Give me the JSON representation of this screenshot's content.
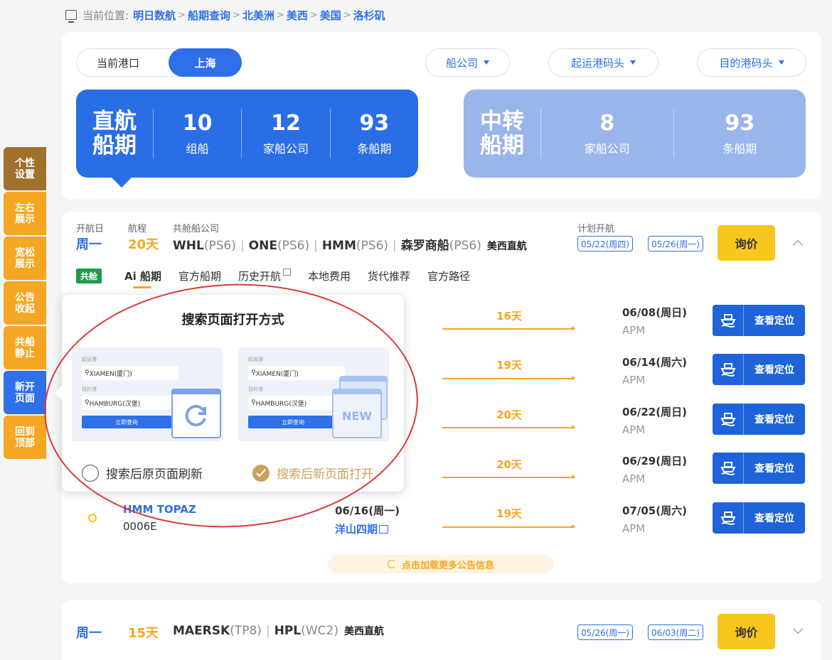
{
  "breadcrumb": {
    "prefix": "当前位置:",
    "items": [
      "明日数航",
      "船期查询",
      "北美洲",
      "美西",
      "美国",
      "洛杉矶"
    ],
    "sep": ">"
  },
  "port_bar": {
    "label": "当前港口",
    "selected": "上海",
    "dropdowns": [
      "船公司",
      "起运港码头",
      "目的港码头"
    ]
  },
  "stats": {
    "direct": {
      "title_line1": "直航",
      "title_line2": "船期",
      "cols": [
        {
          "num": "10",
          "label": "组船"
        },
        {
          "num": "12",
          "label": "家船公司"
        },
        {
          "num": "93",
          "label": "条船期"
        }
      ]
    },
    "transfer": {
      "title_line1": "中转",
      "title_line2": "船期",
      "cols": [
        {
          "num": "8",
          "label": "家船公司"
        },
        {
          "num": "93",
          "label": "条船期"
        }
      ]
    }
  },
  "sidebar": {
    "items": [
      {
        "label": "个性设置",
        "color": "#a0712c"
      },
      {
        "label": "左右展示",
        "color": "#f5a623"
      },
      {
        "label": "宽松展示",
        "color": "#f5a623"
      },
      {
        "label": "公告收起",
        "color": "#f5a623"
      },
      {
        "label": "共船静止",
        "color": "#f5a623"
      },
      {
        "label": "新开页面",
        "color": "#2f6fe8"
      },
      {
        "label": "回到顶部",
        "color": "#f5a623"
      }
    ]
  },
  "route1": {
    "labels": {
      "departure": "开航日",
      "duration": "航程",
      "shared": "共舱船公司",
      "plan": "计划开航"
    },
    "day": "周一",
    "days": "20天",
    "carriers": [
      {
        "name": "WHL",
        "svc": "(PS6)"
      },
      {
        "name": "ONE",
        "svc": "(PS6)"
      },
      {
        "name": "HMM",
        "svc": "(PS6)"
      },
      {
        "name": "森罗商船",
        "svc": "(PS6)"
      }
    ],
    "route_tag": "美西直航",
    "dates": [
      "05/22(周四)",
      "05/26(周一)"
    ],
    "quote": "询价",
    "share_tag": "共舱",
    "tabs": [
      "Ai 船期",
      "官方船期",
      "历史开航",
      "本地费用",
      "货代推荐",
      "官方路径"
    ],
    "rows": [
      {
        "days": "16天",
        "arrive": "06/08(周日)",
        "carrier": "APM"
      },
      {
        "days": "19天",
        "arrive": "06/14(周六)",
        "carrier": "APM"
      },
      {
        "days": "20天",
        "arrive": "06/22(周日)",
        "carrier": "APM"
      },
      {
        "days": "20天",
        "arrive": "06/29(周日)",
        "carrier": "APM"
      },
      {
        "days": "19天",
        "arrive": "07/05(周六)",
        "carrier": "APM"
      }
    ],
    "last_vessel": {
      "name": "HMM TOPAZ",
      "voyage": "0006E",
      "depart": "06/16(周一)",
      "terminal": "洋山四期"
    },
    "locate_label": "查看定位",
    "load_more": "点击加载更多公告信息"
  },
  "popup": {
    "title": "搜索页面打开方式",
    "mock": {
      "from_label": "起运港",
      "to_label": "目的港",
      "from": "XIAMEN(厦门)",
      "to": "HAMBURG(汉堡)",
      "button": "立即查询",
      "new_badge": "NEW"
    },
    "options": [
      {
        "label": "搜索后原页面刷新",
        "selected": false
      },
      {
        "label": "搜索后新页面打开",
        "selected": true
      }
    ]
  },
  "route2": {
    "day": "周一",
    "days": "15天",
    "carriers": [
      {
        "name": "MAERSK",
        "svc": "(TP8)"
      },
      {
        "name": "HPL",
        "svc": "(WC2)"
      }
    ],
    "route_tag": "美西直航",
    "dates": [
      "05/26(周一)",
      "06/03(周二)"
    ],
    "quote": "询价"
  },
  "colors": {
    "primary": "#2f6fe8",
    "accent": "#f5a623",
    "quote": "#f8c61d",
    "annotation": "#d83a3a"
  }
}
